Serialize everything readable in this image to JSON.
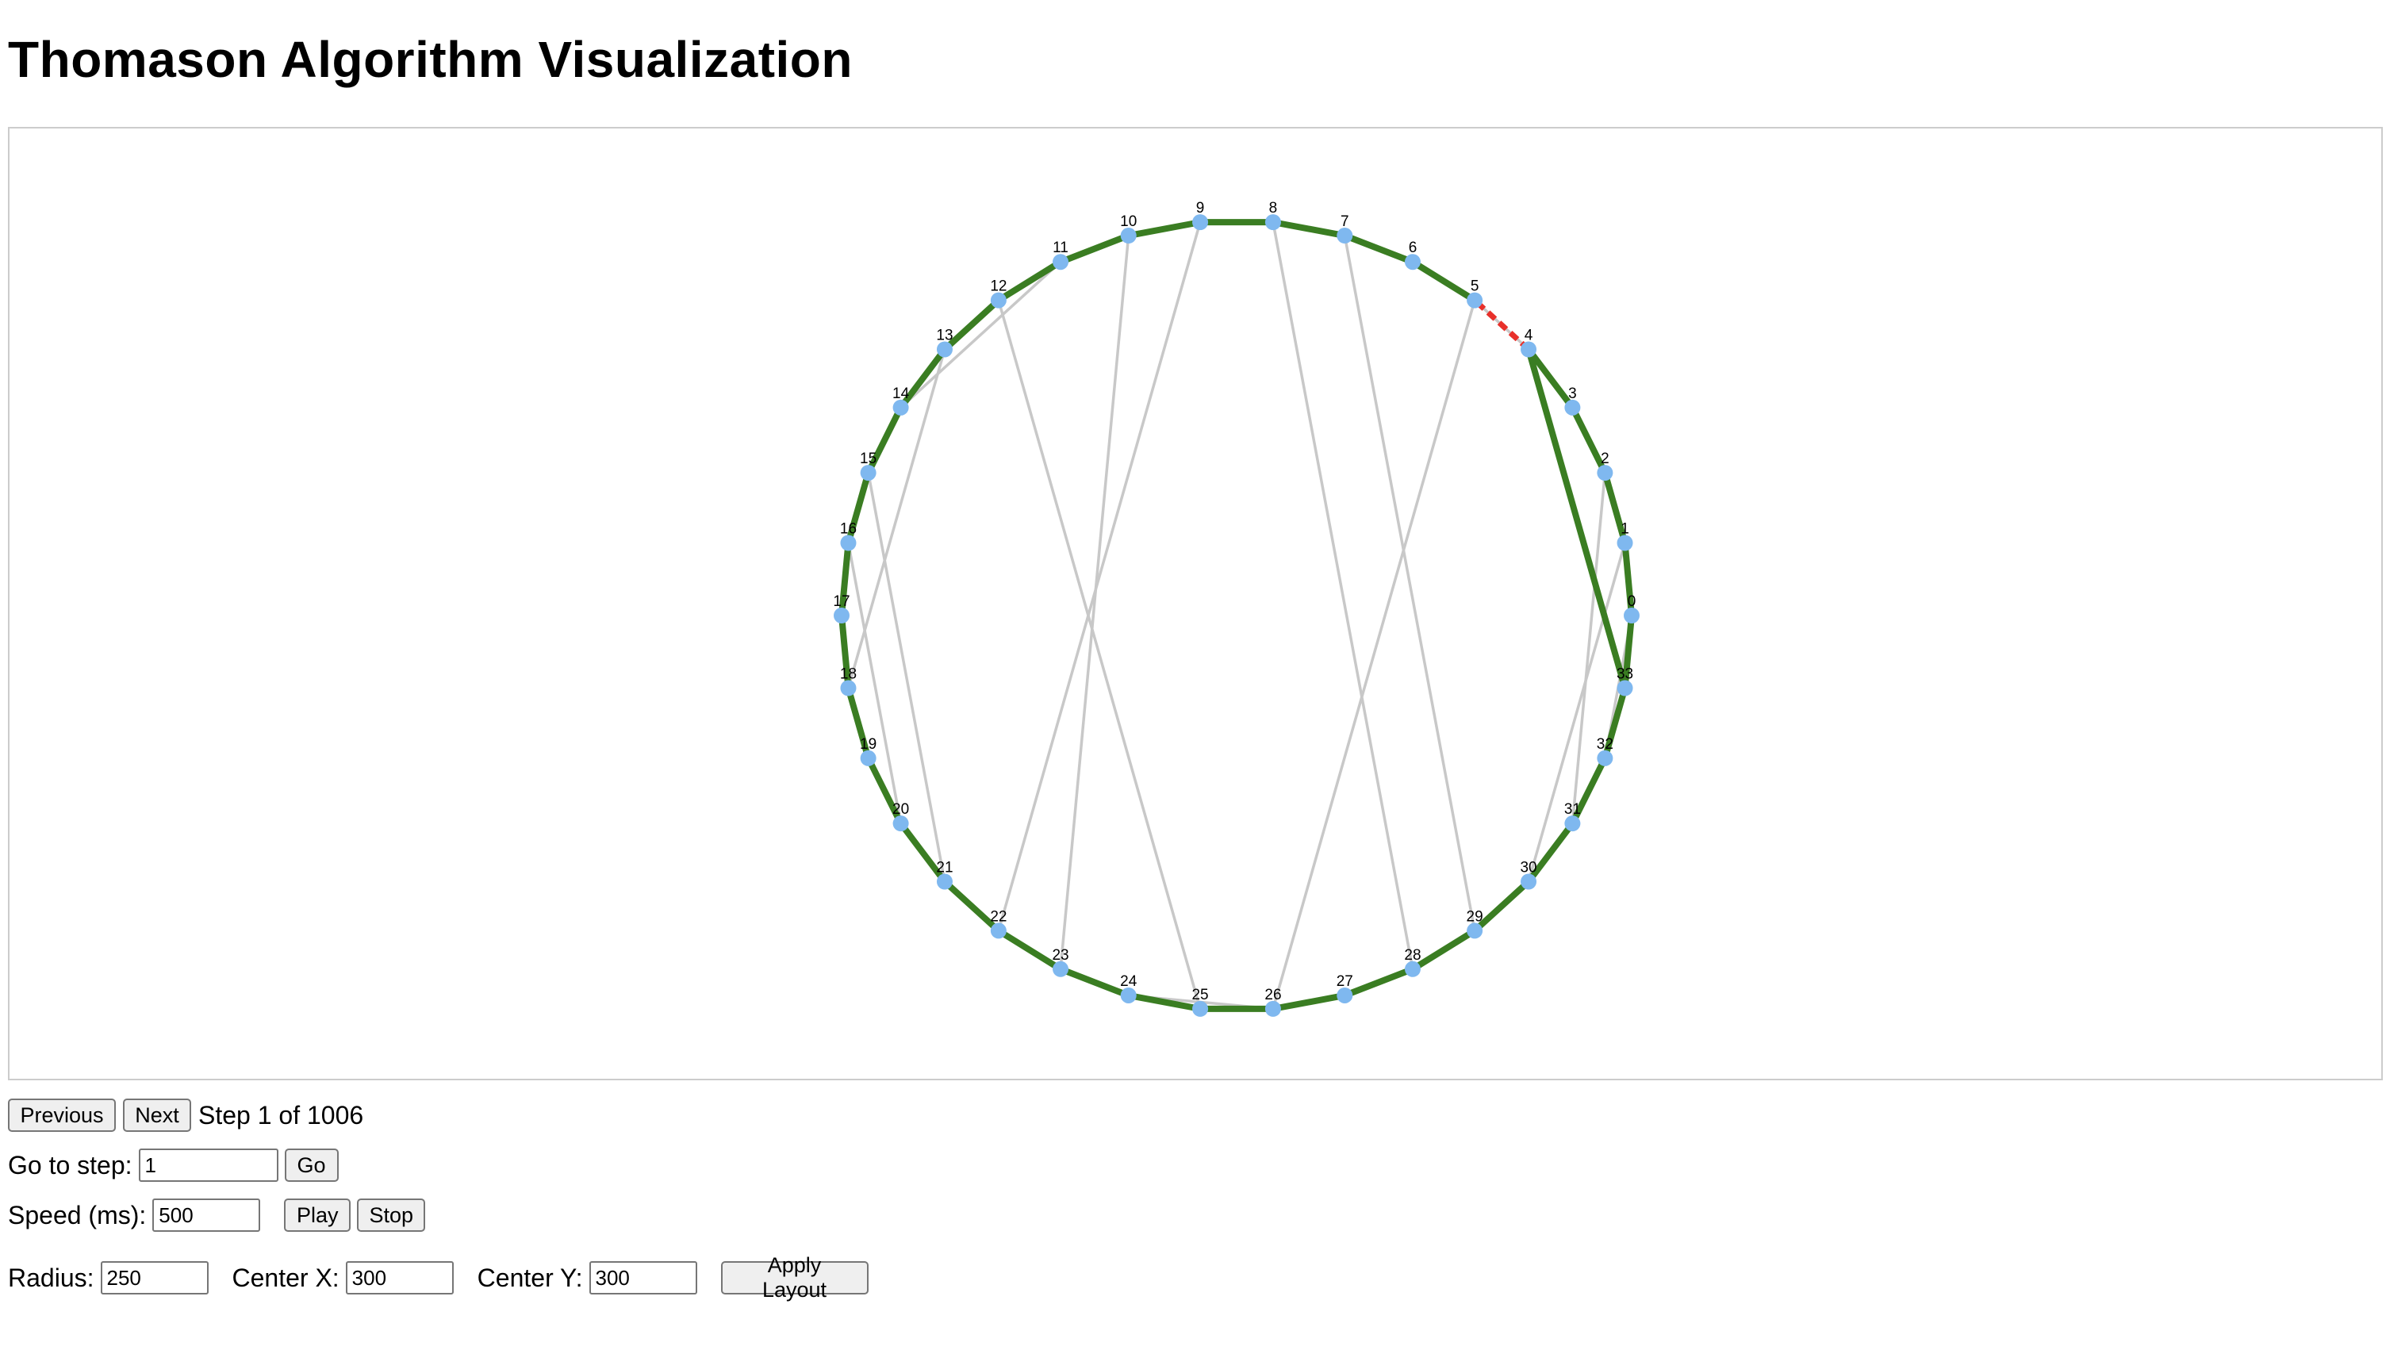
{
  "page": {
    "title": "Thomason Algorithm Visualization"
  },
  "graph": {
    "node_count": 34,
    "colors": {
      "node": "#7fb8ef",
      "cycle_edge": "#3a7d22",
      "other_edge": "#c8c8c8",
      "highlight_edge": "#e8302a",
      "label": "#000000"
    },
    "nodes": [
      "0",
      "1",
      "2",
      "3",
      "4",
      "5",
      "6",
      "7",
      "8",
      "9",
      "10",
      "11",
      "12",
      "13",
      "14",
      "15",
      "16",
      "17",
      "18",
      "19",
      "20",
      "21",
      "22",
      "23",
      "24",
      "25",
      "26",
      "27",
      "28",
      "29",
      "30",
      "31",
      "32",
      "33"
    ],
    "cycle_edges": [
      [
        0,
        1
      ],
      [
        1,
        2
      ],
      [
        2,
        3
      ],
      [
        3,
        4
      ],
      [
        5,
        6
      ],
      [
        6,
        7
      ],
      [
        7,
        8
      ],
      [
        8,
        9
      ],
      [
        9,
        10
      ],
      [
        10,
        11
      ],
      [
        11,
        12
      ],
      [
        12,
        13
      ],
      [
        13,
        14
      ],
      [
        14,
        15
      ],
      [
        15,
        16
      ],
      [
        16,
        17
      ],
      [
        17,
        18
      ],
      [
        18,
        19
      ],
      [
        19,
        20
      ],
      [
        20,
        21
      ],
      [
        21,
        22
      ],
      [
        22,
        23
      ],
      [
        23,
        24
      ],
      [
        24,
        25
      ],
      [
        25,
        26
      ],
      [
        26,
        27
      ],
      [
        27,
        28
      ],
      [
        28,
        29
      ],
      [
        29,
        30
      ],
      [
        30,
        31
      ],
      [
        31,
        32
      ],
      [
        32,
        33
      ],
      [
        33,
        0
      ],
      [
        33,
        4
      ]
    ],
    "other_edges": [
      [
        24,
        26
      ],
      [
        25,
        12
      ],
      [
        23,
        10
      ],
      [
        22,
        9
      ],
      [
        21,
        15
      ],
      [
        20,
        16
      ],
      [
        18,
        13
      ],
      [
        14,
        11
      ],
      [
        28,
        8
      ],
      [
        29,
        7
      ],
      [
        26,
        5
      ],
      [
        30,
        1
      ],
      [
        31,
        2
      ],
      [
        32,
        0
      ],
      [
        4,
        5
      ]
    ],
    "highlight_edges": [
      [
        4,
        5
      ]
    ]
  },
  "nav": {
    "previous_label": "Previous",
    "next_label": "Next",
    "step_text": "Step 1 of 1006"
  },
  "goto": {
    "label": "Go to step:",
    "value": "1",
    "button_label": "Go"
  },
  "speed": {
    "label": "Speed (ms):",
    "value": "500",
    "play_label": "Play",
    "stop_label": "Stop"
  },
  "layout": {
    "radius_label": "Radius:",
    "radius_value": "250",
    "center_x_label": "Center X:",
    "center_x_value": "300",
    "center_y_label": "Center Y:",
    "center_y_value": "300",
    "apply_label": "Apply Layout"
  }
}
